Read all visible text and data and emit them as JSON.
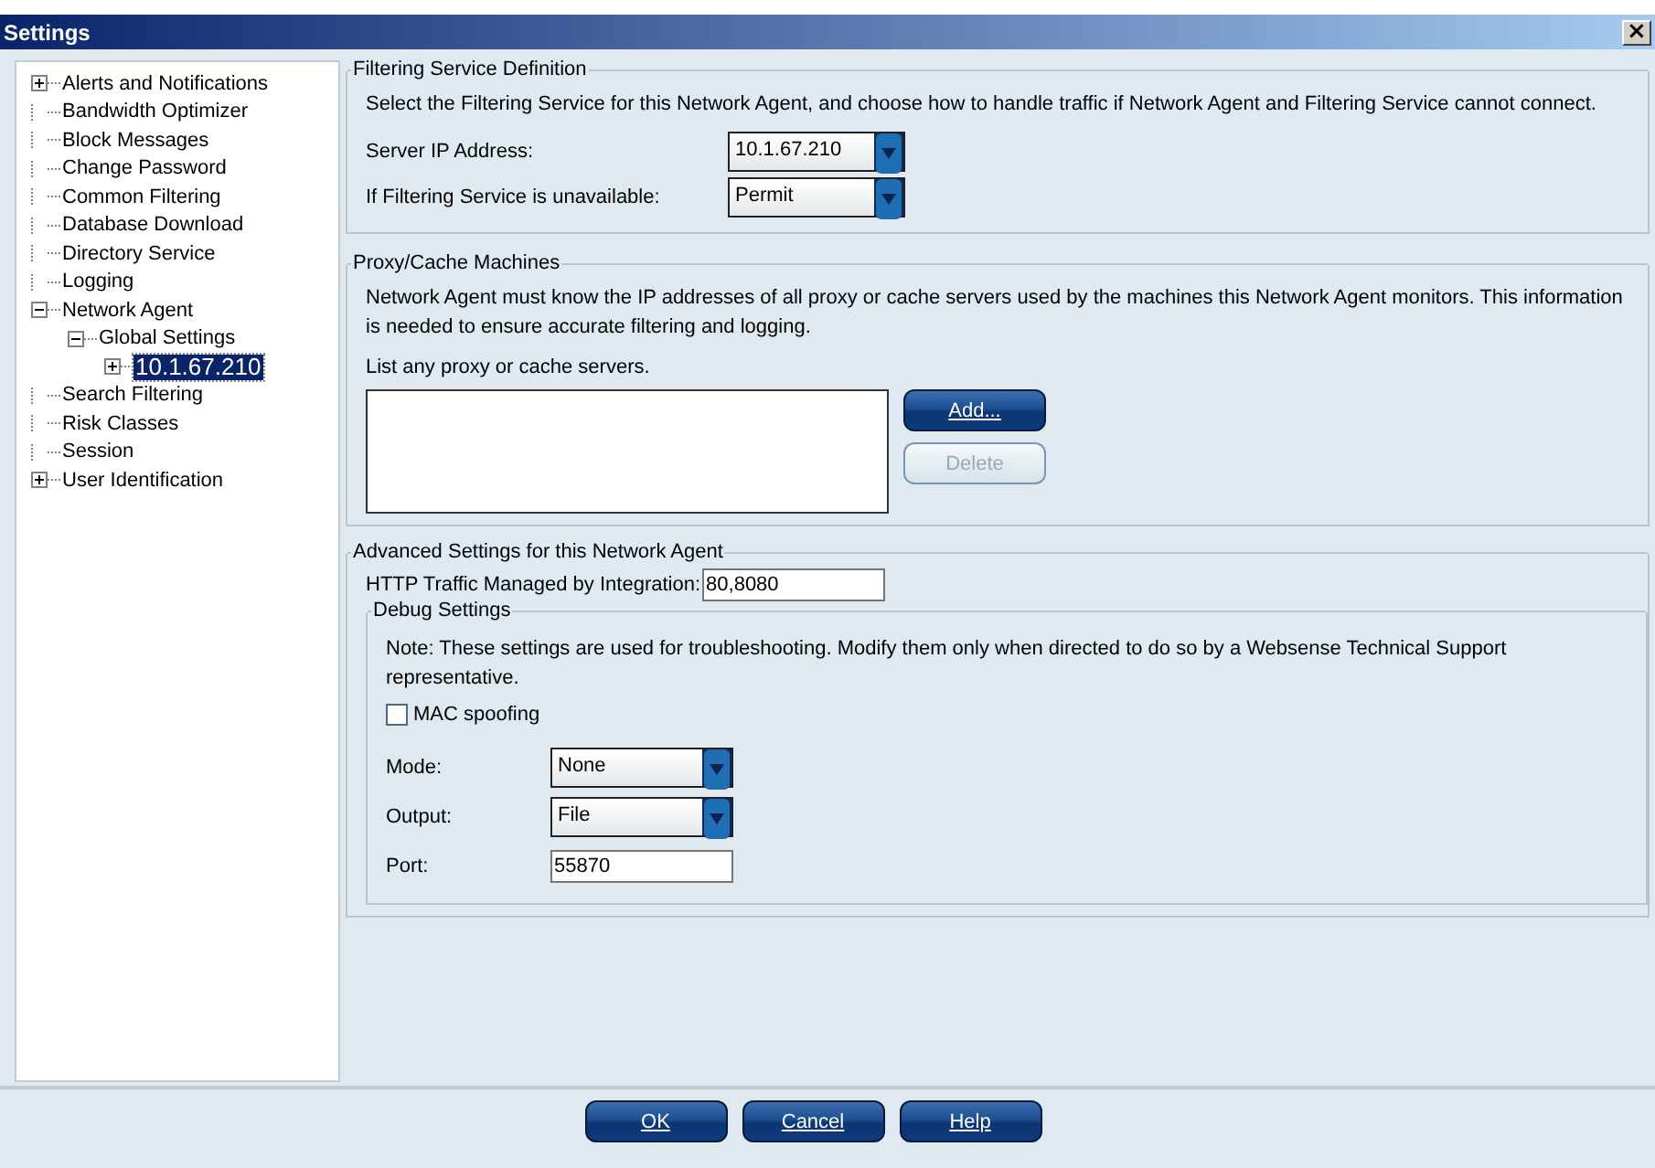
{
  "window": {
    "title": "Settings",
    "close": "×"
  },
  "tree": [
    {
      "label": "Alerts and Notifications",
      "kind": "collapsed",
      "selected": false
    },
    {
      "label": "Bandwidth Optimizer",
      "kind": "leaf",
      "selected": false
    },
    {
      "label": "Block Messages",
      "kind": "leaf",
      "selected": false
    },
    {
      "label": "Change Password",
      "kind": "leaf",
      "selected": false
    },
    {
      "label": "Common Filtering",
      "kind": "leaf",
      "selected": false
    },
    {
      "label": "Database Download",
      "kind": "leaf",
      "selected": false
    },
    {
      "label": "Directory Service",
      "kind": "leaf",
      "selected": false
    },
    {
      "label": "Logging",
      "kind": "leaf",
      "selected": false
    },
    {
      "label": "Network Agent",
      "kind": "expanded",
      "selected": false,
      "children": [
        {
          "label": "Global Settings",
          "kind": "expanded",
          "selected": false,
          "children": [
            {
              "label": "10.1.67.210",
              "kind": "collapsed",
              "selected": true
            }
          ]
        }
      ]
    },
    {
      "label": "Search Filtering",
      "kind": "leaf",
      "selected": false
    },
    {
      "label": "Risk Classes",
      "kind": "leaf",
      "selected": false
    },
    {
      "label": "Session",
      "kind": "leaf",
      "selected": false
    },
    {
      "label": "User Identification",
      "kind": "collapsed",
      "selected": false
    }
  ],
  "filtering_service": {
    "title": "Filtering Service Definition",
    "description": "Select the Filtering Service for this Network Agent, and choose how to handle traffic if Network Agent and Filtering Service cannot connect.",
    "fields": [
      {
        "label": "Server IP Address:",
        "value": "10.1.67.210"
      },
      {
        "label": "If Filtering Service is unavailable:",
        "value": "Permit"
      }
    ]
  },
  "proxy_cache": {
    "title": "Proxy/Cache Machines",
    "description": "Network Agent must know the IP addresses of all proxy or cache servers used by the machines this Network Agent monitors. This information is needed to ensure accurate filtering and logging.",
    "list_label": "List any proxy or cache servers.",
    "buttons": [
      {
        "label": "Add...",
        "disabled": false
      },
      {
        "label": "Delete",
        "disabled": true
      }
    ]
  },
  "advanced": {
    "title": "Advanced Settings for this Network Agent",
    "http_label": "HTTP Traffic Managed by Integration:",
    "http_value": "80,8080",
    "debug": {
      "title": "Debug Settings",
      "note": "Note: These settings are used for troubleshooting. Modify them only when directed to do so by a Websense Technical Support representative.",
      "mac_spoofing": {
        "label": "MAC spoofing",
        "checked": false
      },
      "fields": [
        {
          "label": "Mode:",
          "value": "None",
          "kind": "combo"
        },
        {
          "label": "Output:",
          "value": "File",
          "kind": "combo"
        },
        {
          "label": "Port:",
          "value": "55870",
          "kind": "text"
        }
      ]
    }
  },
  "buttons": [
    "OK",
    "Cancel",
    "Help"
  ]
}
